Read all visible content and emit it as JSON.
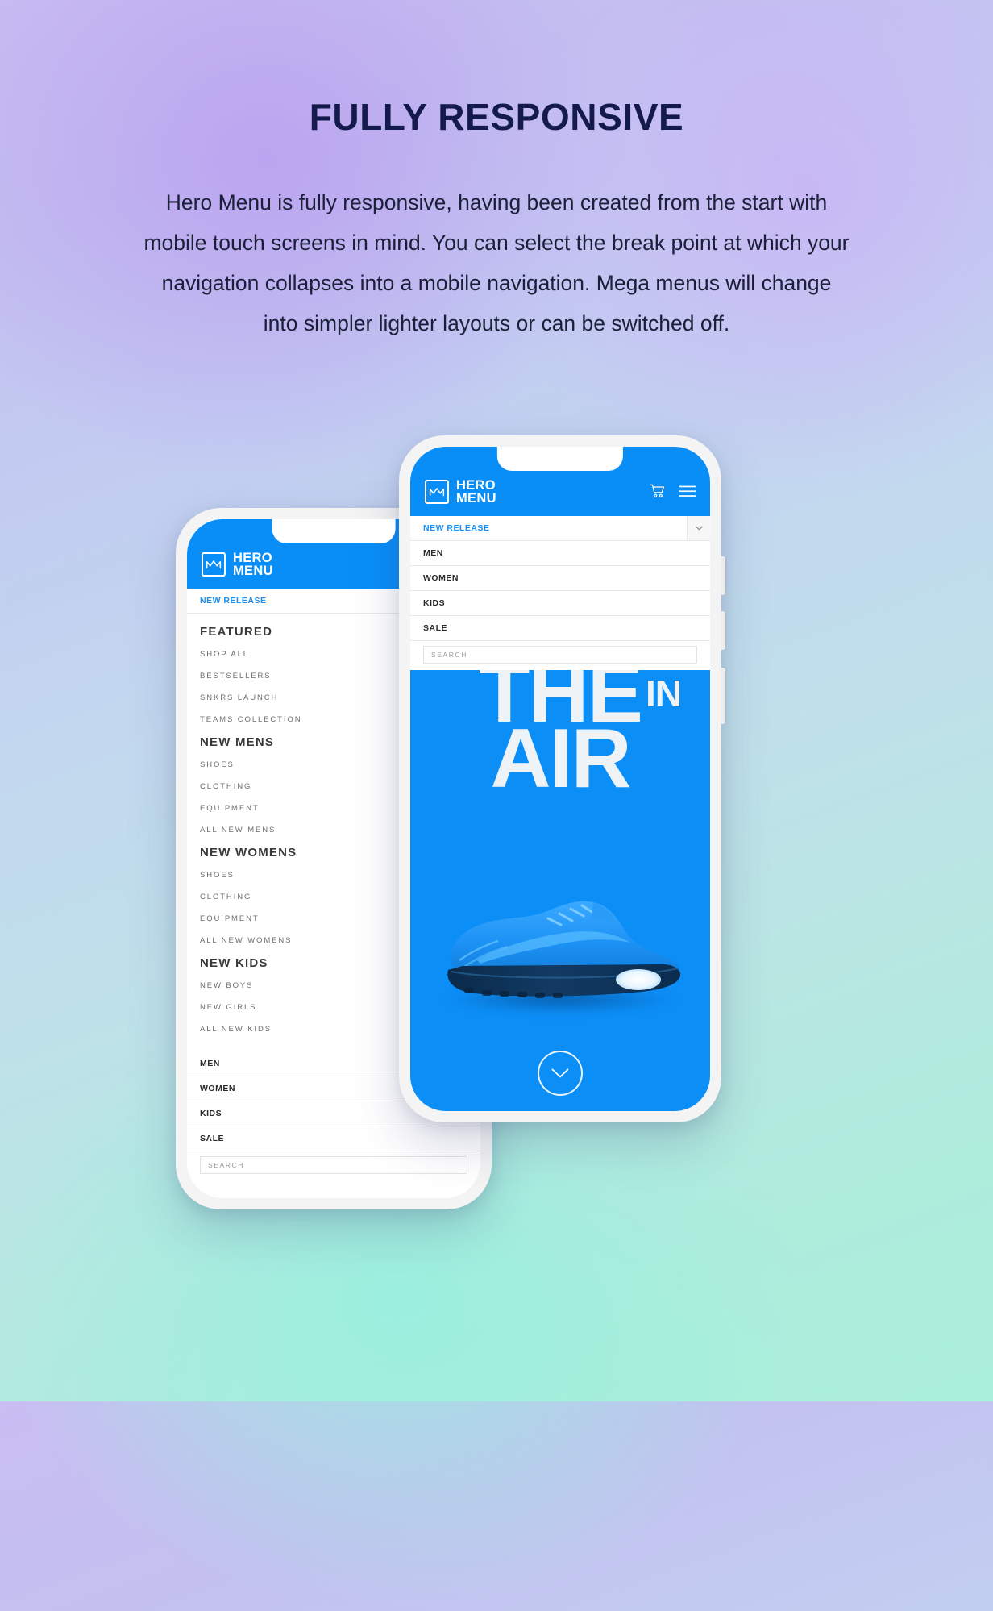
{
  "header": {
    "title": "FULLY RESPONSIVE",
    "description": "Hero Menu is fully responsive, having been created from the start with mobile touch screens in mind. You can select the break point at which your navigation collapses into a mobile navigation. Mega menus will change into simpler lighter layouts or can be switched off."
  },
  "colors": {
    "brand_blue": "#098EF8",
    "link_blue": "#1B8FF2",
    "title_navy": "#141A4B",
    "hero_white": "#EEF3F7"
  },
  "brand": {
    "line1": "HERO",
    "line2": "MENU",
    "mark_icon": "logo-mark-icon"
  },
  "toolbar": {
    "cart_icon": "cart-icon",
    "menu_icon": "hamburger-icon"
  },
  "nav": {
    "active_label": "NEW RELEASE",
    "chevron_icon": "chevron-down-icon",
    "items": [
      {
        "label": "MEN"
      },
      {
        "label": "WOMEN"
      },
      {
        "label": "KIDS"
      },
      {
        "label": "SALE"
      }
    ]
  },
  "search": {
    "placeholder": "SEARCH",
    "value": ""
  },
  "mega_menu": {
    "groups": [
      {
        "title": "FEATURED",
        "links": [
          "SHOP ALL",
          "BESTSELLERS",
          "SNKRS LAUNCH",
          "TEAMS COLLECTION"
        ]
      },
      {
        "title": "NEW MENS",
        "links": [
          "SHOES",
          "CLOTHING",
          "EQUIPMENT",
          "ALL NEW MENS"
        ]
      },
      {
        "title": "NEW WOMENS",
        "links": [
          "SHOES",
          "CLOTHING",
          "EQUIPMENT",
          "ALL NEW WOMENS"
        ]
      },
      {
        "title": "NEW KIDS",
        "links": [
          "NEW BOYS",
          "NEW GIRLS",
          "ALL NEW KIDS"
        ]
      }
    ]
  },
  "hero": {
    "word_the": "THE",
    "word_in": "IN",
    "word_air": "AIR",
    "product_icon": "sneaker-image",
    "scroll_icon": "chevron-down-circle-icon"
  }
}
